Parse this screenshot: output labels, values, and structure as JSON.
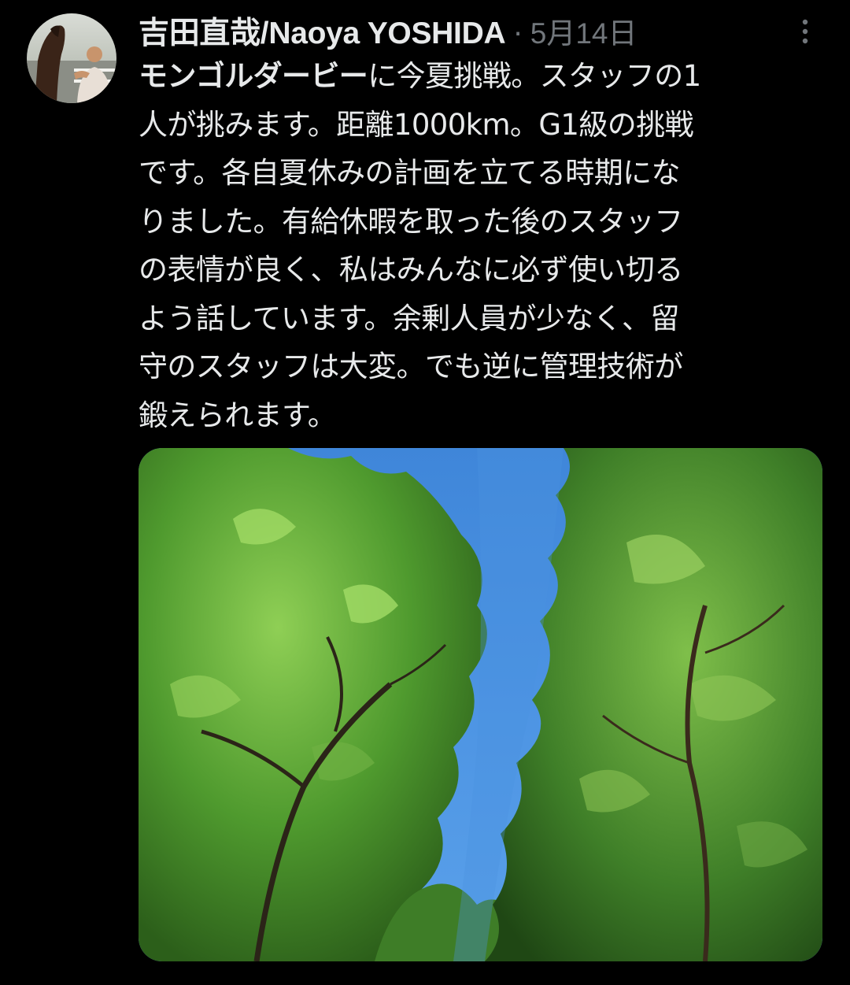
{
  "tweet": {
    "author": {
      "display_name": "吉田直哉/Naoya YOSHIDA",
      "avatar_icon": "avatar-photo-horse-and-man"
    },
    "separator": "·",
    "date": "5月14日",
    "more_icon": "more-vertical-icon",
    "text": {
      "lead_bold": "モンゴルダービー",
      "lines": [
        "に今夏挑戦。スタッフの1",
        "人が挑みます。距離1000km。G1級の挑戦",
        "です。各自夏休みの計画を立てる時期にな",
        "りました。有給休暇を取った後のスタッフ",
        "の表情が良く、私はみんなに必ず使い切る",
        "よう話しています。余剰人員が少なく、留",
        "守のスタッフは大変。でも逆に管理技術が",
        "鍛えられます。"
      ]
    },
    "media": {
      "type": "photo",
      "subject": "trees-against-blue-sky"
    },
    "colors": {
      "background": "#000000",
      "text": "#e7e9ea",
      "secondary": "#71767b"
    }
  }
}
